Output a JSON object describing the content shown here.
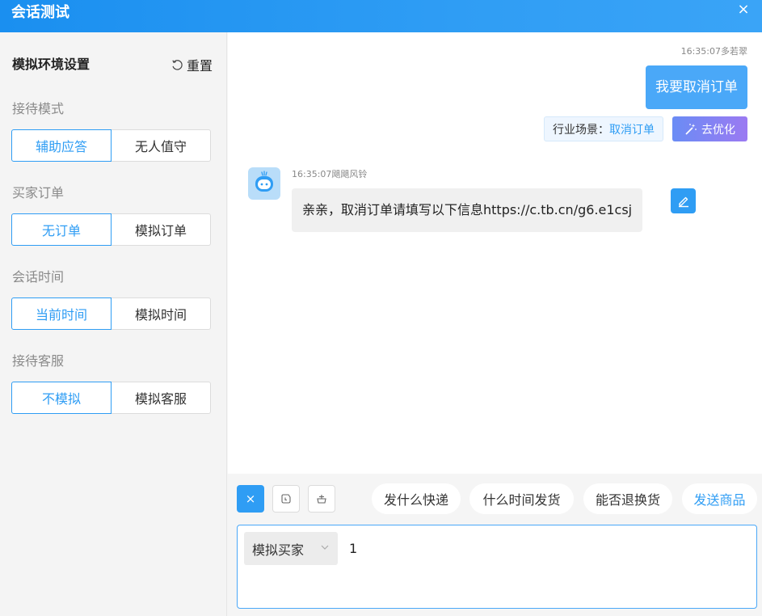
{
  "window": {
    "title": "会话测试",
    "close_glyph": "×"
  },
  "sidebar": {
    "title": "模拟环境设置",
    "reset_label": "重置",
    "groups": [
      {
        "label": "接待模式",
        "options": [
          "辅助应答",
          "无人值守"
        ],
        "selected": 0
      },
      {
        "label": "买家订单",
        "options": [
          "无订单",
          "模拟订单"
        ],
        "selected": 0
      },
      {
        "label": "会话时间",
        "options": [
          "当前时间",
          "模拟时间"
        ],
        "selected": 0
      },
      {
        "label": "接待客服",
        "options": [
          "不模拟",
          "模拟客服"
        ],
        "selected": 0
      }
    ]
  },
  "chat": {
    "outgoing": {
      "meta": "16:35:07多若翠",
      "text": "我要取消订单"
    },
    "scene_tag": {
      "label": "行业场景：",
      "value": "取消订单"
    },
    "optimize_label": "去优化",
    "incoming": {
      "meta": "16:35:07飓飓风铃",
      "text": "亲亲，取消订单请填写以下信息https://c.tb.cn/g6.e1csj"
    }
  },
  "composer": {
    "close_glyph": "×",
    "quick_replies": [
      "发什么快递",
      "什么时间发货",
      "能否退换货",
      "发送商品"
    ],
    "role": "模拟买家",
    "input_value": "1"
  },
  "colors": {
    "accent": "#2f9df4",
    "title_bar": "#1a8ff0",
    "bubble_out": "#4aa8f8",
    "optimize_gradient": [
      "#6a8cf5",
      "#9b7af2"
    ]
  }
}
